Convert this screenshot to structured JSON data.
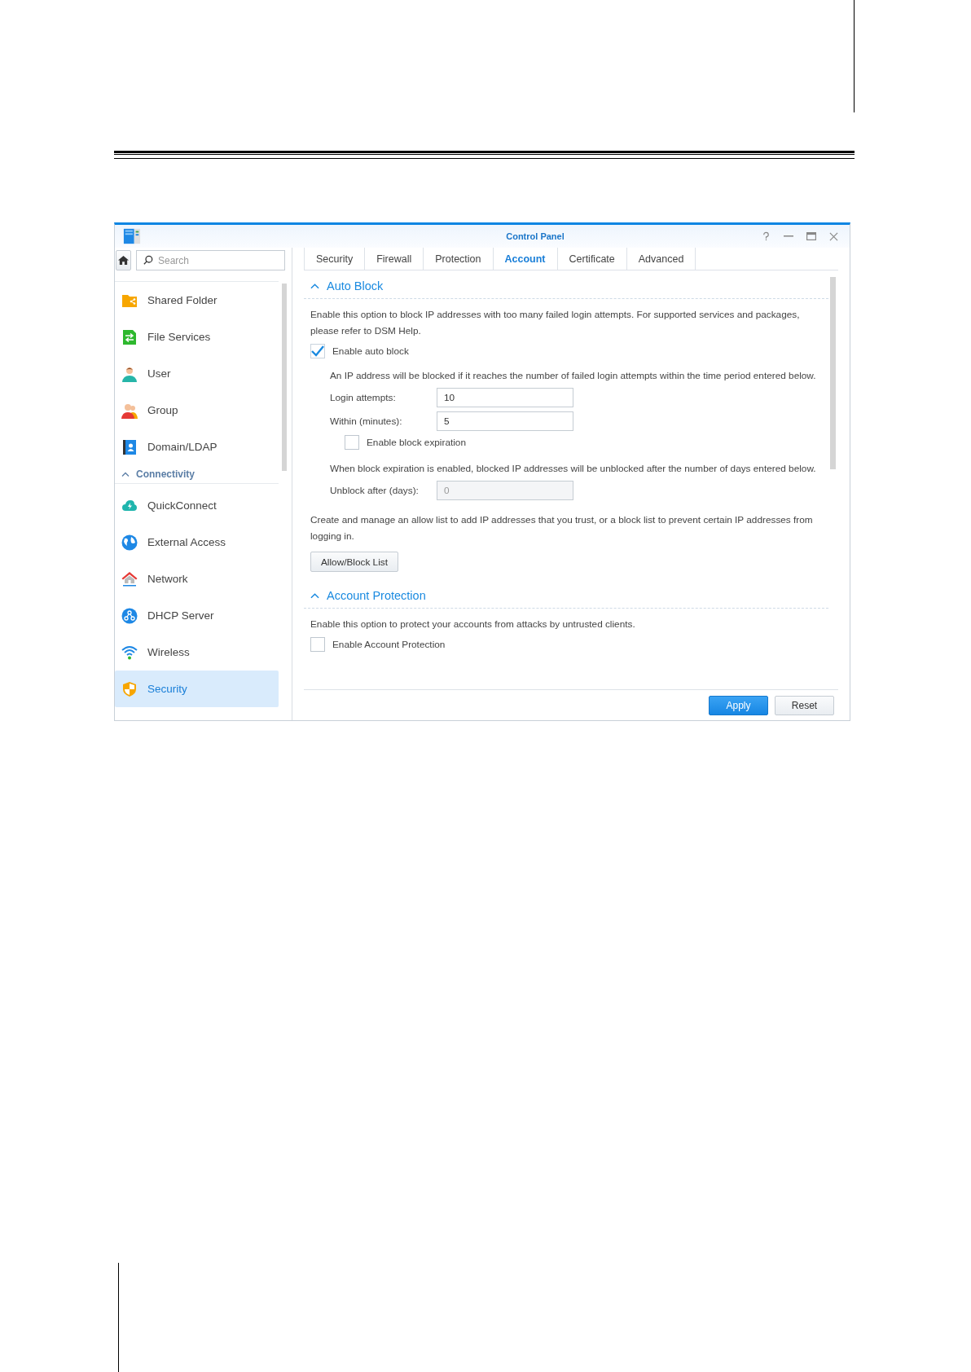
{
  "window": {
    "title": "Control Panel"
  },
  "sidebar": {
    "search": {
      "placeholder": "Search"
    },
    "items": [
      {
        "label": "Shared Folder",
        "selected": false
      },
      {
        "label": "File Services",
        "selected": false
      },
      {
        "label": "User",
        "selected": false
      },
      {
        "label": "Group",
        "selected": false
      },
      {
        "label": "Domain/LDAP",
        "selected": false
      }
    ],
    "groups": [
      {
        "title": "Connectivity",
        "expanded": true,
        "items": [
          {
            "label": "QuickConnect",
            "selected": false
          },
          {
            "label": "External Access",
            "selected": false
          },
          {
            "label": "Network",
            "selected": false
          },
          {
            "label": "DHCP Server",
            "selected": false
          },
          {
            "label": "Wireless",
            "selected": false
          },
          {
            "label": "Security",
            "selected": true
          }
        ]
      }
    ]
  },
  "tabs": [
    {
      "label": "Security",
      "selected": false
    },
    {
      "label": "Firewall",
      "selected": false
    },
    {
      "label": "Protection",
      "selected": false
    },
    {
      "label": "Account",
      "selected": true
    },
    {
      "label": "Certificate",
      "selected": false
    },
    {
      "label": "Advanced",
      "selected": false
    }
  ],
  "auto_block": {
    "title": "Auto Block",
    "expanded": true,
    "description": "Enable this option to block IP addresses with too many failed login attempts. For supported services and packages, please refer to DSM Help.",
    "enable": {
      "label": "Enable auto block",
      "checked": true
    },
    "note": "An IP address will be blocked if it reaches the number of failed login attempts within the time period entered below.",
    "fields": [
      {
        "label": "Login attempts:",
        "value": "10",
        "disabled": false
      },
      {
        "label": "Within (minutes):",
        "value": "5",
        "disabled": false
      }
    ],
    "expiration": {
      "label": "Enable block expiration",
      "checked": false
    },
    "expiration_note": "When block expiration is enabled, blocked IP addresses will be unblocked after the number of days entered below.",
    "unblock": {
      "label": "Unblock after (days):",
      "value": "0",
      "disabled": true
    },
    "list_note": "Create and manage an allow list to add IP addresses that you trust, or a block list to prevent certain IP addresses from logging in.",
    "list_button": "Allow/Block List"
  },
  "account_protection": {
    "title": "Account Protection",
    "expanded": true,
    "description": "Enable this option to protect your accounts from attacks by untrusted clients.",
    "enable": {
      "label": "Enable Account Protection",
      "checked": false
    }
  },
  "footer": {
    "buttons": [
      {
        "label": "Apply",
        "kind": "primary"
      },
      {
        "label": "Reset",
        "kind": "secondary"
      }
    ]
  }
}
